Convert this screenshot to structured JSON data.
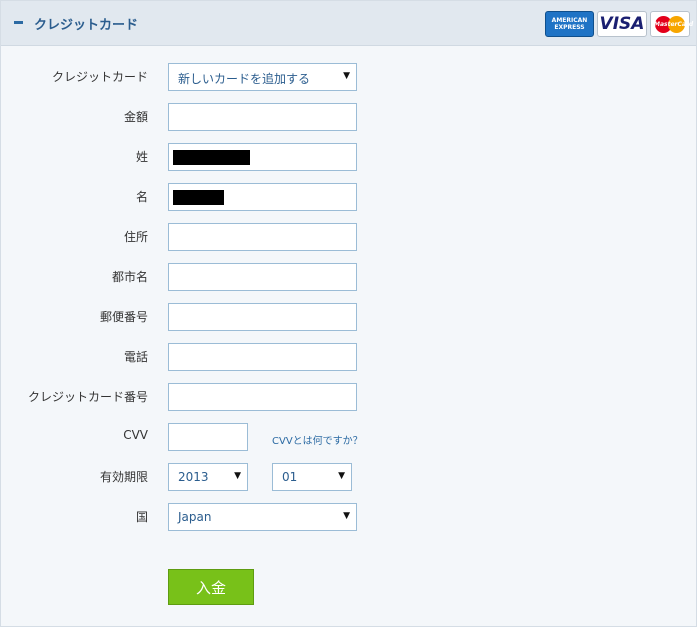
{
  "header": {
    "title": "クレジットカード",
    "logos": {
      "amex_line1": "AMERICAN",
      "amex_line2": "EXPRESS",
      "visa": "VISA",
      "mastercard": "MasterCard"
    }
  },
  "form": {
    "card_select": {
      "label": "クレジットカード",
      "value": "新しいカードを追加する"
    },
    "amount": {
      "label": "金額",
      "value": ""
    },
    "last_name": {
      "label": "姓",
      "value": ""
    },
    "first_name": {
      "label": "名",
      "value": ""
    },
    "address": {
      "label": "住所",
      "value": ""
    },
    "city": {
      "label": "都市名",
      "value": ""
    },
    "postal_code": {
      "label": "郵便番号",
      "value": ""
    },
    "phone": {
      "label": "電話",
      "value": ""
    },
    "card_number": {
      "label": "クレジットカード番号",
      "value": ""
    },
    "cvv": {
      "label": "CVV",
      "value": "",
      "help_link": "CVVとは何ですか？"
    },
    "expiry": {
      "label": "有効期限",
      "year": "2013",
      "month": "01"
    },
    "country": {
      "label": "国",
      "value": "Japan"
    },
    "submit_label": "入金"
  },
  "icons": {
    "collapse": "minus-icon",
    "dropdown": "triangle-down-icon"
  },
  "colors": {
    "header_bg": "#e1e8ef",
    "accent": "#2b6aa3",
    "submit_bg": "#78c119",
    "field_border": "#9bbcd6"
  }
}
